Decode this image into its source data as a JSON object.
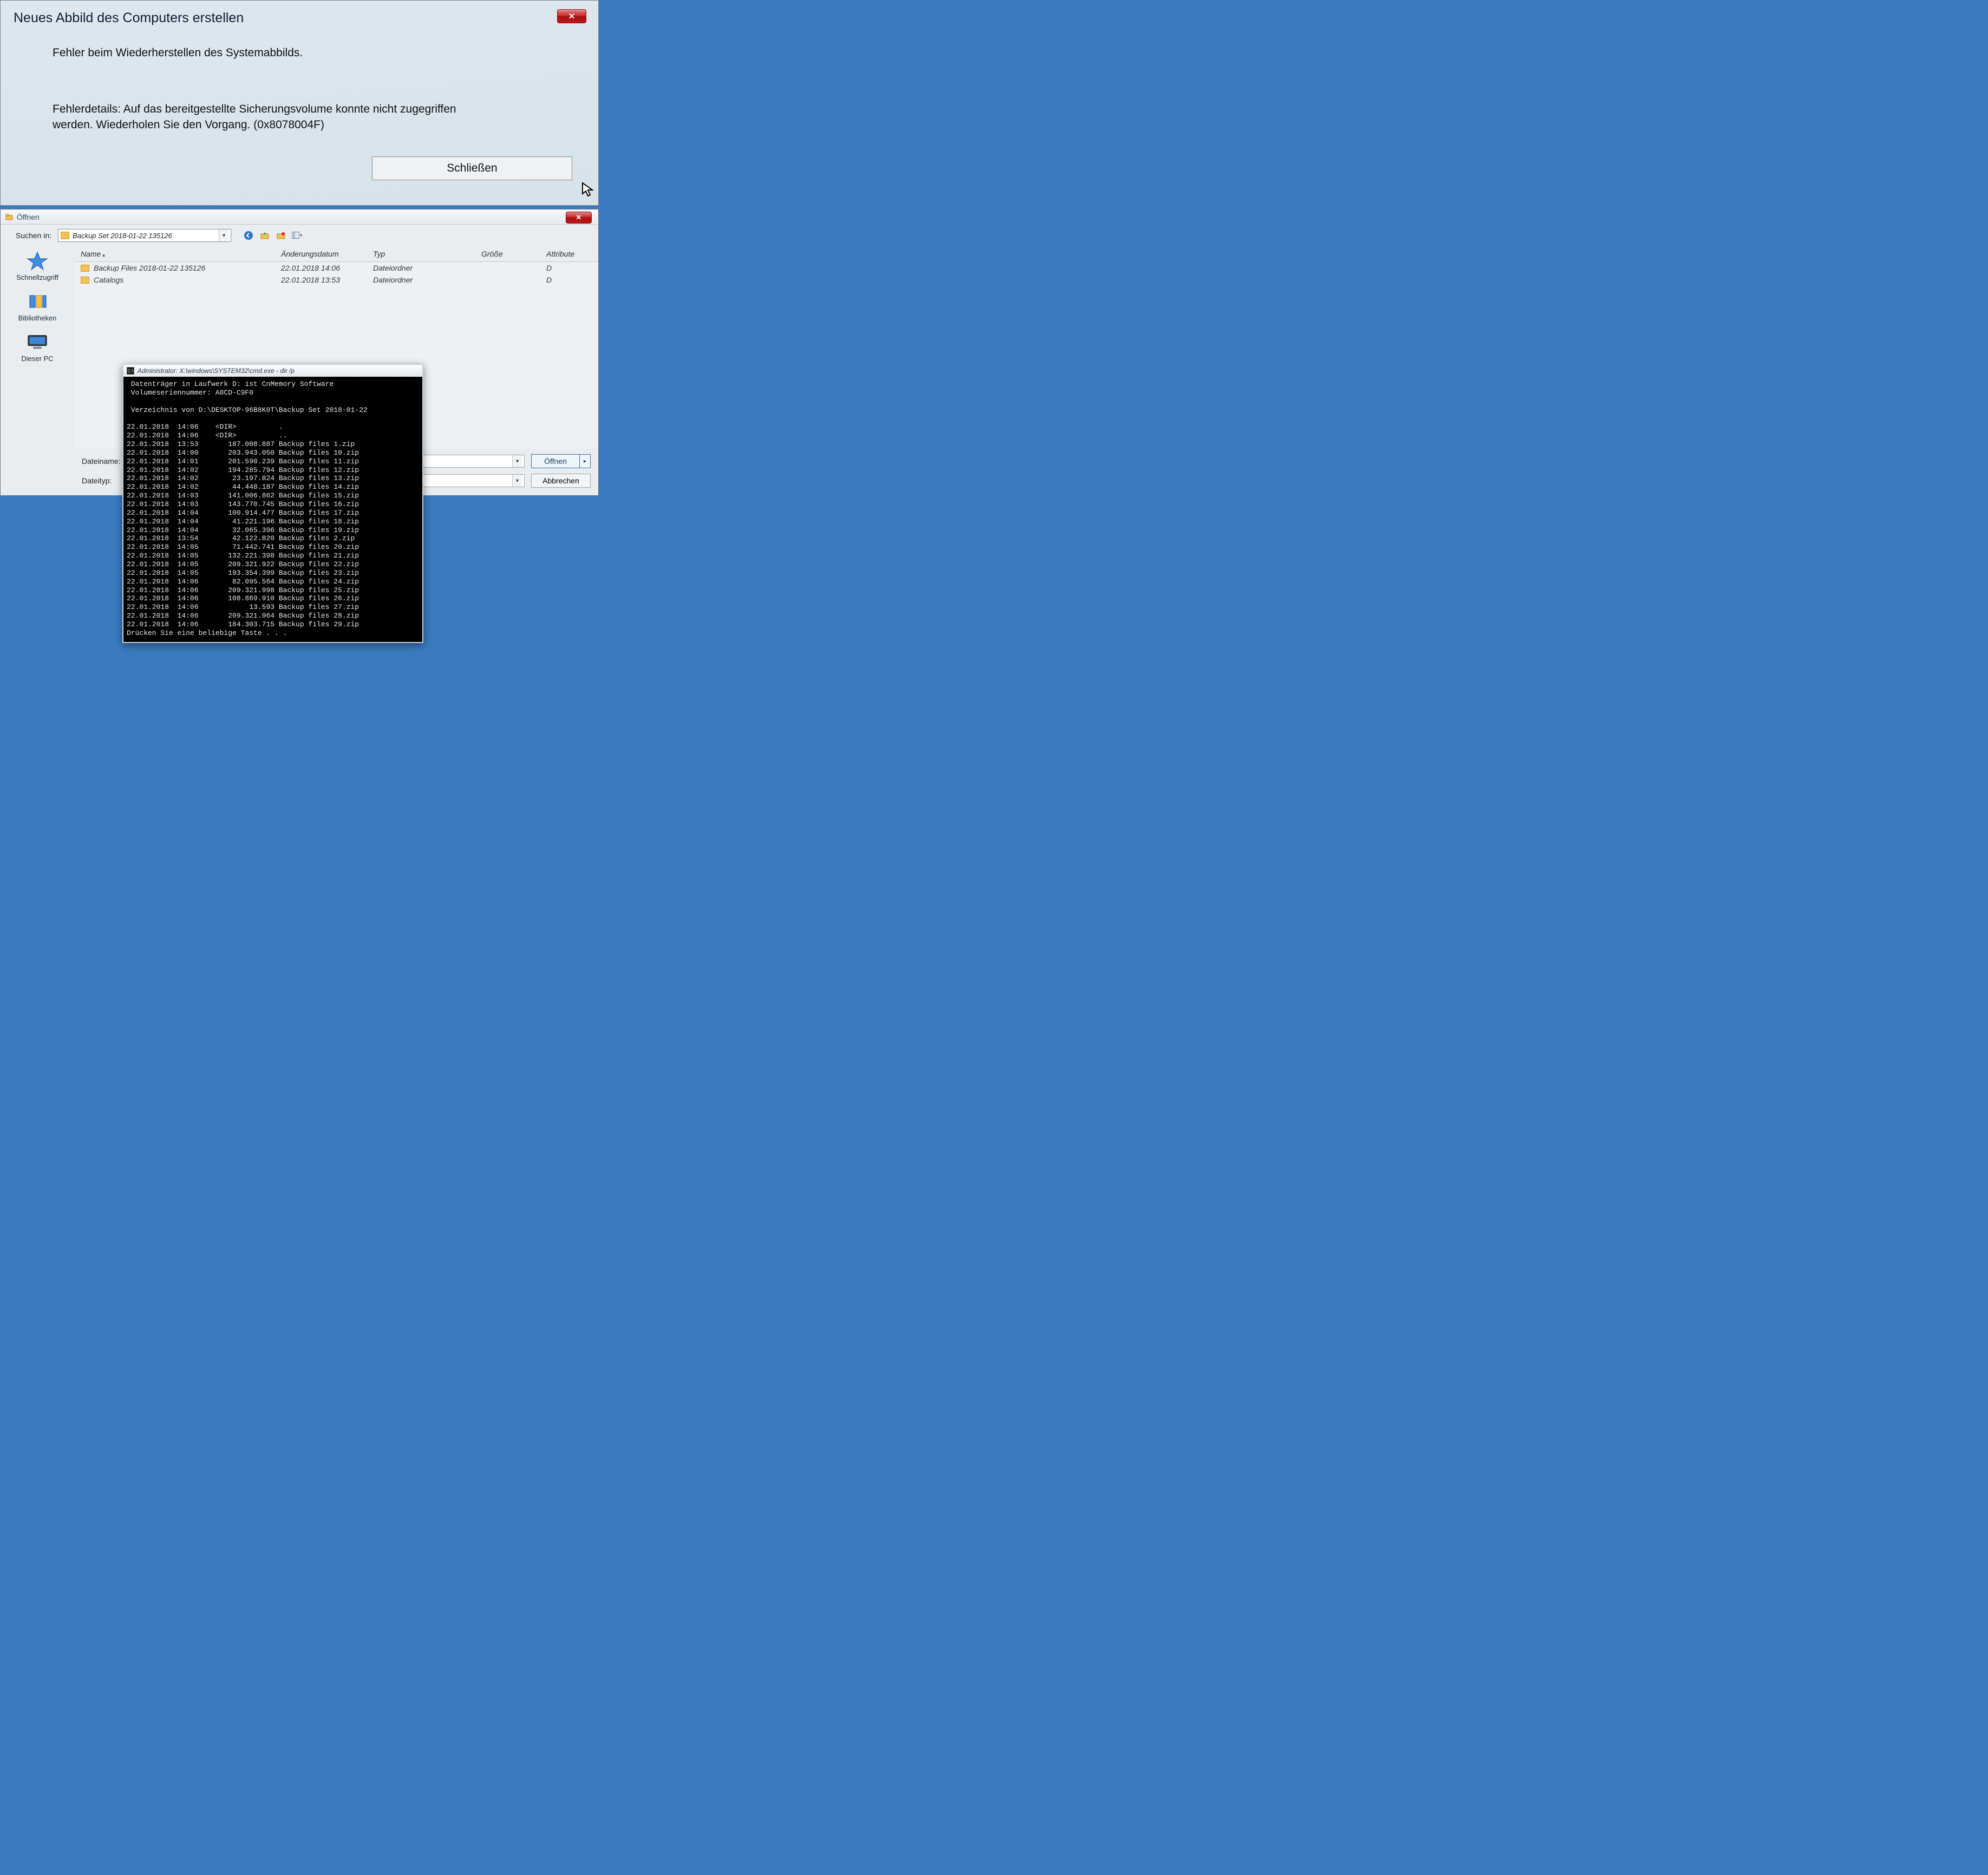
{
  "error_dialog": {
    "title": "Neues Abbild des Computers erstellen",
    "message": "Fehler beim Wiederherstellen des Systemabbilds.",
    "details": "Fehlerdetails: Auf das bereitgestellte Sicherungsvolume konnte nicht zugegriffen werden. Wiederholen Sie den Vorgang. (0x8078004F)",
    "close_label": "Schließen",
    "x_label": "✕"
  },
  "open_dialog": {
    "title": "Öffnen",
    "search_in_label": "Suchen in:",
    "location": "Backup Set 2018-01-22 135126",
    "places": {
      "quick_access": "Schnellzugriff",
      "libraries": "Bibliotheken",
      "this_pc": "Dieser PC"
    },
    "columns": {
      "name": "Name",
      "modified": "Änderungsdatum",
      "type": "Typ",
      "size": "Größe",
      "attributes": "Attribute"
    },
    "rows": [
      {
        "name": "Backup Files 2018-01-22 135126",
        "modified": "22.01.2018 14:06",
        "type": "Dateiordner",
        "size": "",
        "attr": "D"
      },
      {
        "name": "Catalogs",
        "modified": "22.01.2018 13:53",
        "type": "Dateiordner",
        "size": "",
        "attr": "D"
      }
    ],
    "filename_label": "Dateiname:",
    "filetype_label": "Dateityp:",
    "open_btn": "Öffnen",
    "cancel_btn": "Abbrechen"
  },
  "cmd": {
    "title": "Administrator: X:\\windows\\SYSTEM32\\cmd.exe - dir /p",
    "header1": "Datenträger in Laufwerk D: ist CnMemory Software",
    "header2": "Volumeseriennummer: A8CD-C9F0",
    "header3": "Verzeichnis von D:\\DESKTOP-96B8K0T\\Backup Set 2018-01-22",
    "lines": [
      "22.01.2018  14:06    <DIR>          .",
      "22.01.2018  14:06    <DIR>          ..",
      "22.01.2018  13:53       187.008.887 Backup files 1.zip",
      "22.01.2018  14:00       203.943.050 Backup files 10.zip",
      "22.01.2018  14:01       201.590.239 Backup files 11.zip",
      "22.01.2018  14:02       194.285.794 Backup files 12.zip",
      "22.01.2018  14:02        23.197.824 Backup files 13.zip",
      "22.01.2018  14:02        44.448.187 Backup files 14.zip",
      "22.01.2018  14:03       141.006.862 Backup files 15.zip",
      "22.01.2018  14:03       143.770.745 Backup files 16.zip",
      "22.01.2018  14:04       100.914.477 Backup files 17.zip",
      "22.01.2018  14:04        41.221.196 Backup files 18.zip",
      "22.01.2018  14:04        32.065.396 Backup files 19.zip",
      "22.01.2018  13:54        42.122.820 Backup files 2.zip",
      "22.01.2018  14:05        71.442.741 Backup files 20.zip",
      "22.01.2018  14:05       132.221.398 Backup files 21.zip",
      "22.01.2018  14:05       209.321.922 Backup files 22.zip",
      "22.01.2018  14:05       193.354.399 Backup files 23.zip",
      "22.01.2018  14:06        82.095.564 Backup files 24.zip",
      "22.01.2018  14:06       209.321.998 Backup files 25.zip",
      "22.01.2018  14:06       108.869.910 Backup files 26.zip",
      "22.01.2018  14:06            13.593 Backup files 27.zip",
      "22.01.2018  14:06       209.321.964 Backup files 28.zip",
      "22.01.2018  14:06       184.303.715 Backup files 29.zip"
    ],
    "footer": "Drücken Sie eine beliebige Taste . . ."
  }
}
